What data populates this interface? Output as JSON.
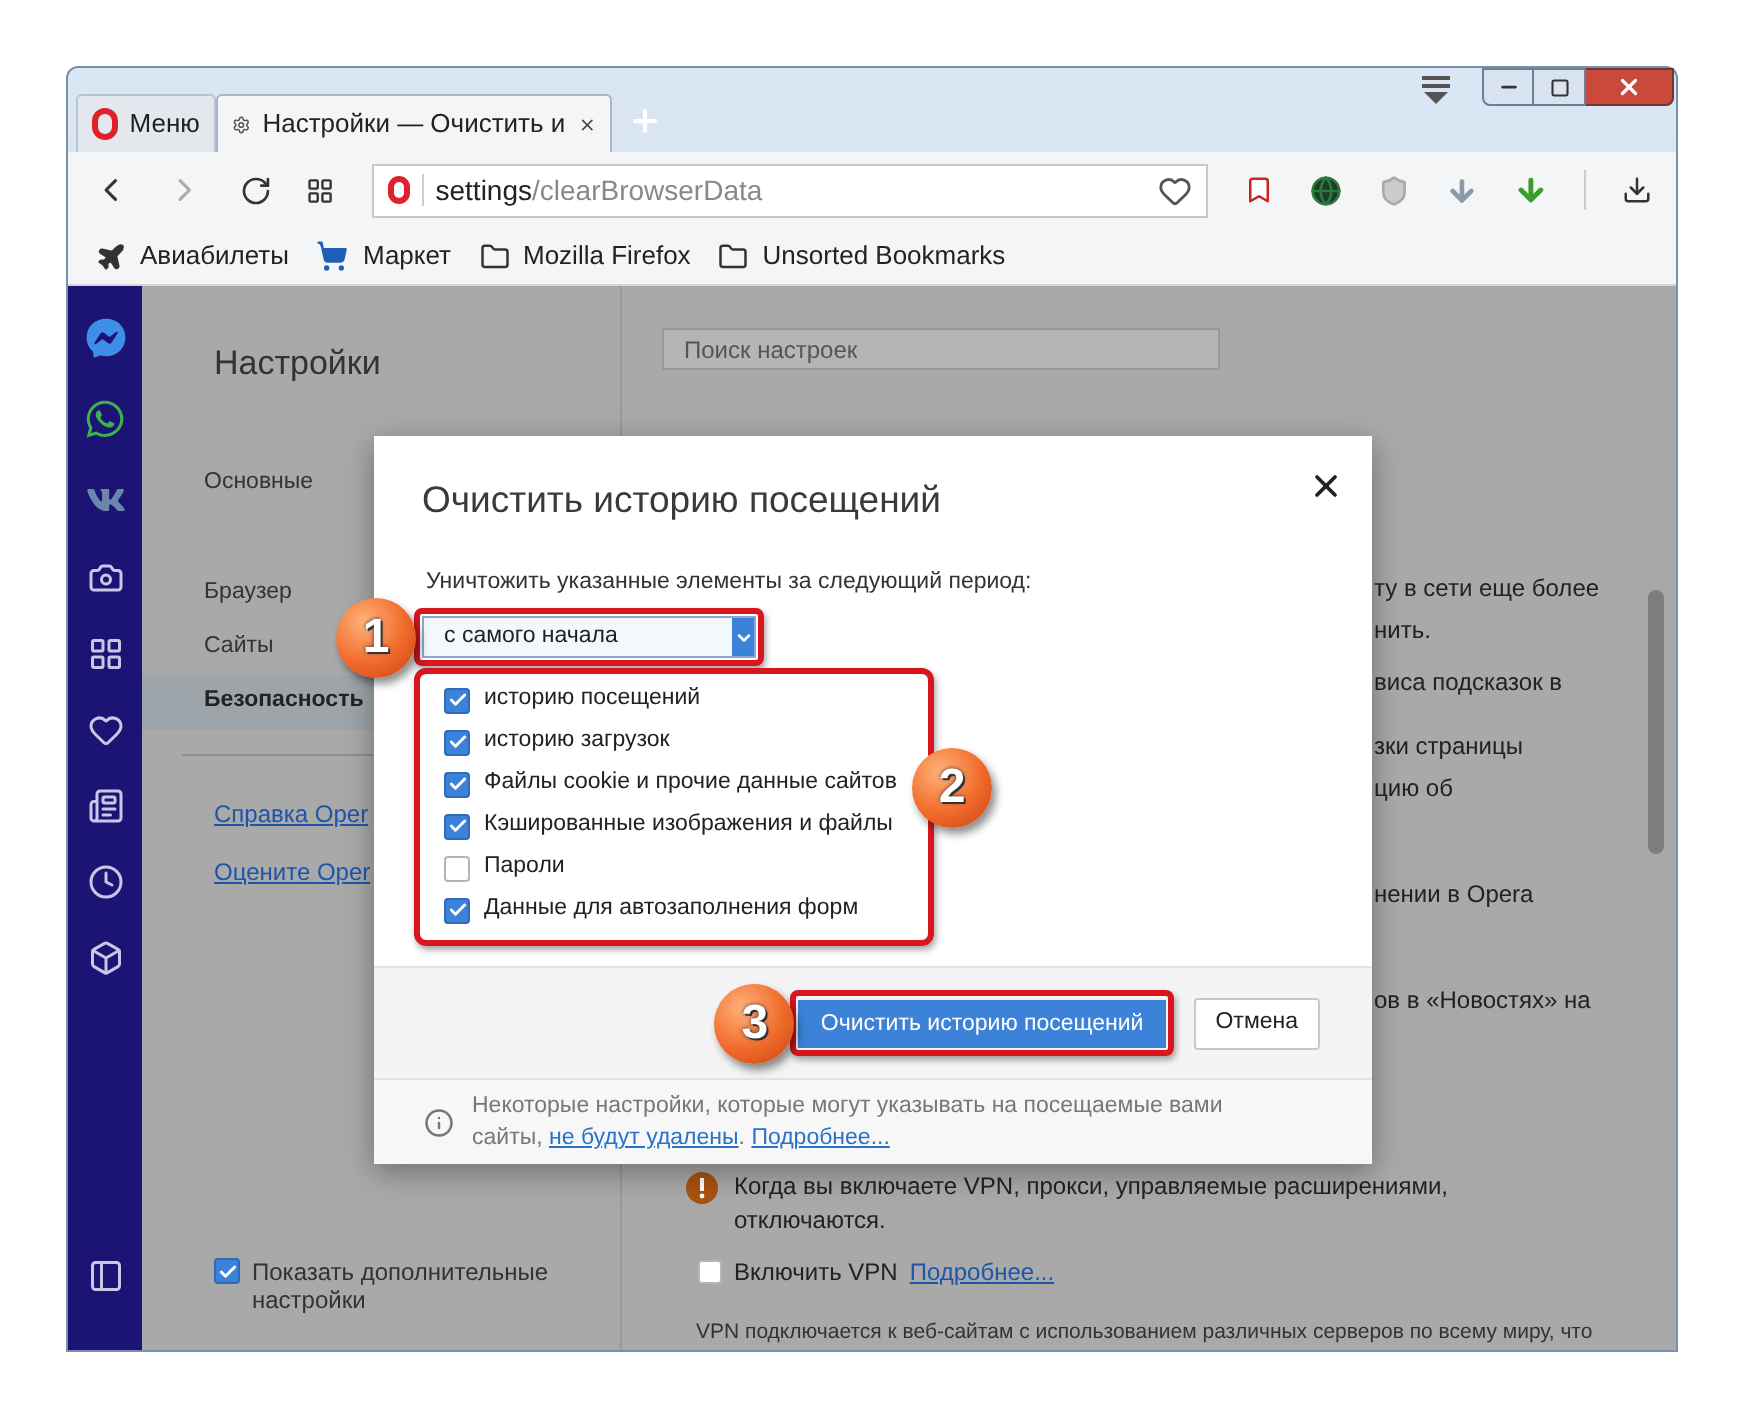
{
  "tabs": [
    {
      "label": "Меню",
      "kind": "menu",
      "selected": false
    },
    {
      "label": "Настройки — Очистить и",
      "kind": "page",
      "selected": true
    }
  ],
  "address_bar": {
    "host": "settings",
    "path": "/clearBrowserData"
  },
  "bookmarks": [
    {
      "label": "Авиабилеты",
      "kind": "plane"
    },
    {
      "label": "Маркет",
      "kind": "cart"
    },
    {
      "label": "Mozilla Firefox",
      "kind": "folder"
    },
    {
      "label": "Unsorted Bookmarks",
      "kind": "folder"
    }
  ],
  "settings": {
    "title": "Настройки",
    "search_placeholder": "Поиск настроек",
    "nav": [
      {
        "label": "Основные",
        "selected": false
      },
      {
        "label": "Браузер",
        "selected": false
      },
      {
        "label": "Сайты",
        "selected": false
      },
      {
        "label": "Безопасность",
        "selected": true
      }
    ],
    "links": [
      "Справка Oper",
      "Оцените Oper"
    ],
    "show_advanced": {
      "label": "Показать дополнительные настройки",
      "checked": true
    }
  },
  "background_fragments": [
    "ту в сети еще более",
    "нить.",
    "виса подсказок в",
    "зки страницы",
    "цию об",
    "нении в Opera",
    "ов в «Новостях» на"
  ],
  "vpn_warning": "Когда вы включаете VPN, прокси, управляемые расширениями, отключаются.",
  "vpn": {
    "label": "Включить VPN",
    "checked": false,
    "link": "Подробнее..."
  },
  "vpn_note": "VPN подключается к веб-сайтам с использованием различных серверов по всему миру, что",
  "dialog": {
    "title": "Очистить историю посещений",
    "period_label": "Уничтожить указанные элементы за следующий период:",
    "period_value": "с самого начала",
    "items": [
      {
        "label": "историю посещений",
        "checked": true
      },
      {
        "label": "историю загрузок",
        "checked": true
      },
      {
        "label": "Файлы cookie и прочие данные сайтов",
        "checked": true
      },
      {
        "label": "Кэшированные изображения и файлы",
        "checked": true
      },
      {
        "label": "Пароли",
        "checked": false
      },
      {
        "label": "Данные для автозаполнения форм",
        "checked": true
      }
    ],
    "clear_button": "Очистить историю посещений",
    "cancel_button": "Отмена",
    "note_text": "Некоторые настройки, которые могут указывать на посещаемые вами сайты,",
    "note_link1": "не будут удалены",
    "note_sep": ".",
    "note_link2": "Подробнее..."
  },
  "callouts": [
    {
      "number": "1"
    },
    {
      "number": "2"
    },
    {
      "number": "3"
    }
  ]
}
